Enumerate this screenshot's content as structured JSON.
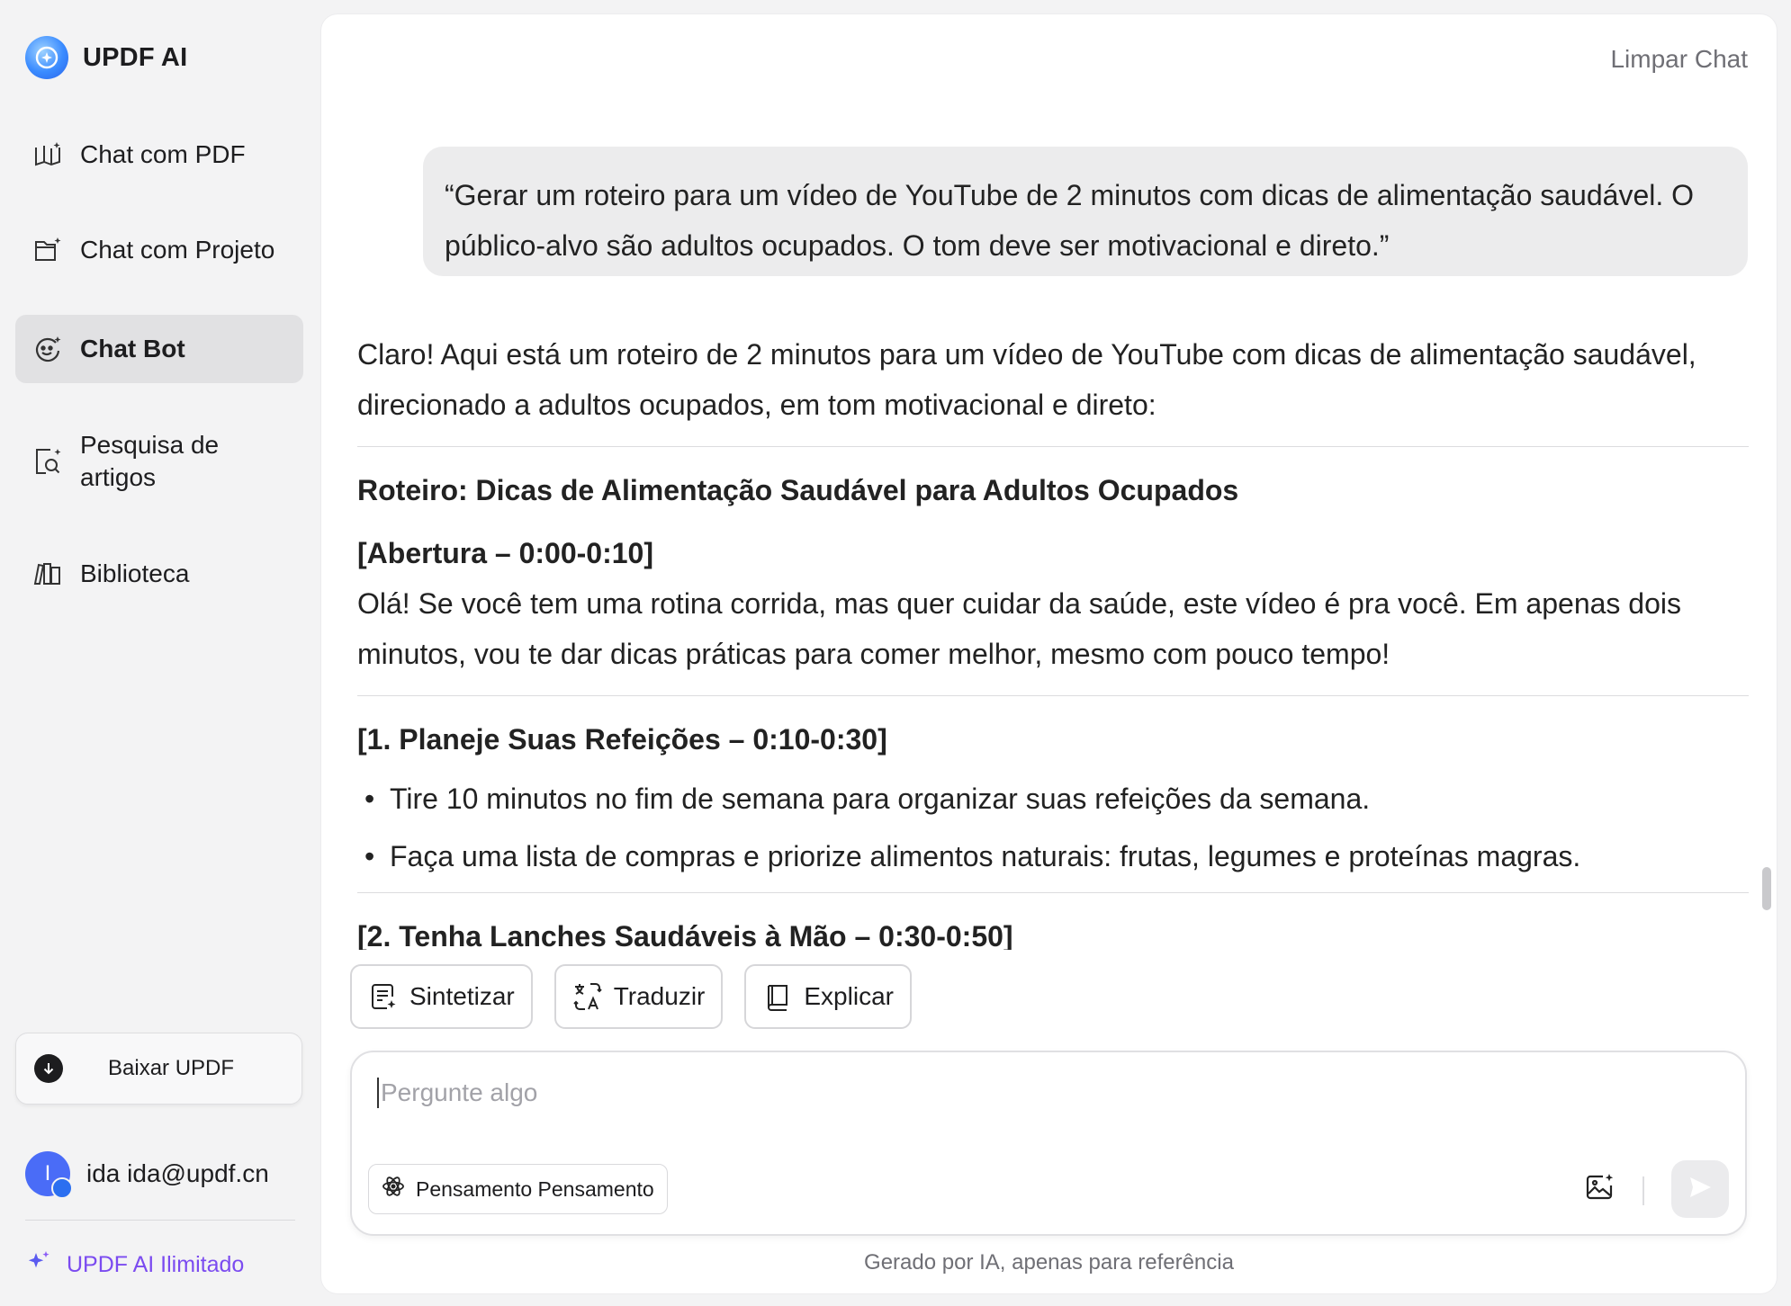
{
  "brand": {
    "name": "UPDF AI"
  },
  "sidebar": {
    "items": [
      {
        "label": "Chat com PDF",
        "icon": "book-sparkle-icon"
      },
      {
        "label": "Chat com Projeto",
        "icon": "folder-sparkle-icon"
      },
      {
        "label": "Chat Bot",
        "icon": "bot-face-icon",
        "active": true
      },
      {
        "label": "Pesquisa de artigos",
        "icon": "doc-search-icon"
      },
      {
        "label": "Biblioteca",
        "icon": "library-icon"
      }
    ],
    "download_label": "Baixar UPDF",
    "user": {
      "initial": "I",
      "label": "ida ida@updf.cn"
    },
    "upgrade_label": "UPDF AI Ilimitado"
  },
  "header": {
    "clear_chat": "Limpar Chat"
  },
  "chat": {
    "user_message": "“Gerar um roteiro para um vídeo de YouTube de 2 minutos com dicas de alimentação saudável. O público-alvo são adultos ocupados. O tom deve ser motivacional e direto.”",
    "answer": {
      "intro": "Claro! Aqui está um roteiro de 2 minutos para um vídeo de YouTube com dicas de alimentação saudável, direcionado a adultos ocupados, em tom motivacional e direto:",
      "title": "Roteiro: Dicas de Alimentação Saudável para Adultos Ocupados",
      "section1_heading": "[Abertura – 0:00-0:10]",
      "section1_text": "Olá! Se você tem uma rotina corrida, mas quer cuidar da saúde, este vídeo é pra você. Em apenas dois minutos, vou te dar dicas práticas para comer melhor, mesmo com pouco tempo!",
      "section2_heading": "[1. Planeje Suas Refeições – 0:10-0:30]",
      "section2_bullets": [
        "Tire 10 minutos no fim de semana para organizar suas refeições da semana.",
        "Faça uma lista de compras e priorize alimentos naturais: frutas, legumes e proteínas magras."
      ],
      "section3_heading": "[2. Tenha Lanches Saudáveis à Mão – 0:30-0:50]"
    }
  },
  "actions": {
    "summarize": "Sintetizar",
    "translate": "Traduzir",
    "explain": "Explicar"
  },
  "composer": {
    "placeholder": "Pergunte algo",
    "value": "",
    "thinking_label": "Pensamento Pensamento"
  },
  "footer": {
    "disclaimer": "Gerado por IA, apenas para referência"
  },
  "colors": {
    "accent": "#7b4bf0",
    "brand_blue": "#3a8bff",
    "active_bg": "#e1e1e3"
  }
}
